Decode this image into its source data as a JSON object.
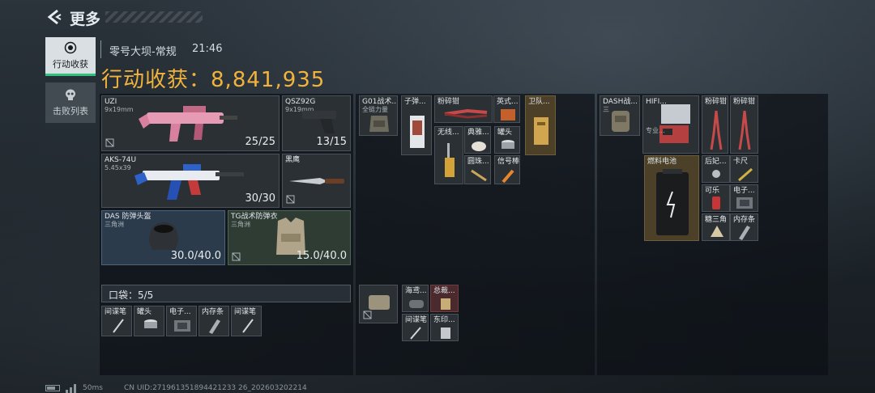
{
  "header": {
    "back_label": "更多"
  },
  "tabs": [
    {
      "label": "行动收获",
      "active": true,
      "icon": "harvest-icon"
    },
    {
      "label": "击败列表",
      "active": false,
      "icon": "skull-icon"
    }
  ],
  "match": {
    "map": "零号大坝-常规",
    "time": "21:46",
    "harvest_label": "行动收获：",
    "harvest_value": "8,841,935"
  },
  "colors": {
    "accent": "#f2b33d",
    "active_tab_underline": "#2ec27e"
  },
  "left": {
    "weapons": [
      {
        "name": "UZI",
        "sub": "9x19mm",
        "count": "25/25"
      },
      {
        "name": "QSZ92G",
        "sub": "9x19mm",
        "count": "13/15"
      },
      {
        "name": "AKS-74U",
        "sub": "5.45x39",
        "count": "30/30"
      },
      {
        "name": "黑鹰",
        "sub": "",
        "count": ""
      }
    ],
    "armor": [
      {
        "name": "DAS 防弹头盔",
        "sub": "三角洲",
        "count": "30.0/40.0"
      },
      {
        "name": "TG战术防弹衣",
        "sub": "三角洲",
        "count": "15.0/40.0"
      }
    ],
    "pocket_label": "口袋：5/5",
    "pocket_items": [
      "间谍笔",
      "罐头",
      "电子...",
      "内存条",
      "间谍笔"
    ]
  },
  "middle": {
    "rig_name": "G01战术...",
    "rig_sub": "全链力量",
    "items": {
      "bullet": "子弹...",
      "pliers": "粉碎钳",
      "pages": "英式...",
      "wireless": "无线...",
      "vase": "典雅...",
      "can": "罐头",
      "book": "卫队...",
      "tube": "圆珠...",
      "flare": "信号棒",
      "ctrl1": "海鸢...",
      "ctrl2": "总裁...",
      "pen": "间谍笔",
      "east": "东印..."
    }
  },
  "right": {
    "backpack_name": "DASH战...",
    "backpack_sub": "三",
    "hifi_name": "HIFI...",
    "hifi_sub": "专业...",
    "pliers1": "粉碎钳",
    "pliers2": "粉碎钳",
    "battery": "燃料电池",
    "items": [
      "后妃...",
      "卡尺",
      "可乐",
      "电子...",
      "糖三角",
      "内存条"
    ]
  },
  "footer": {
    "ping": "50ms",
    "uid": "CN UID:271961351894421233 26_202603202214"
  }
}
